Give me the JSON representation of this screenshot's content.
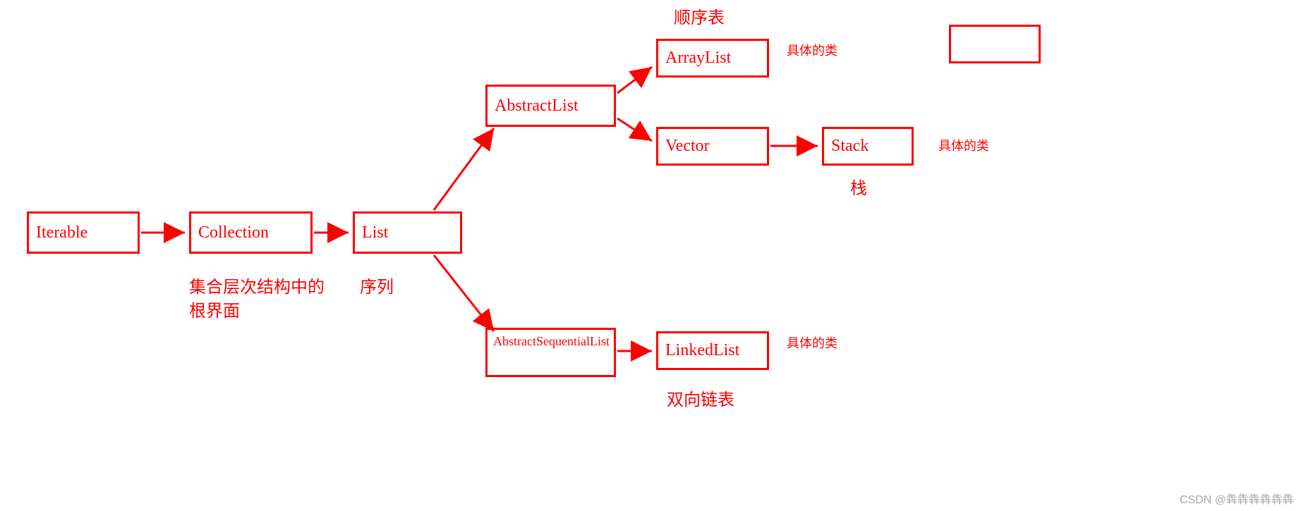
{
  "nodes": {
    "iterable": {
      "text": "Iterable"
    },
    "collection": {
      "text": "Collection"
    },
    "list": {
      "text": "List"
    },
    "abstractlist": {
      "text": "AbstractList"
    },
    "arraylist": {
      "text": "ArrayList"
    },
    "vector": {
      "text": "Vector"
    },
    "stack": {
      "text": "Stack"
    },
    "abstractseq": {
      "text": "AbstractSequentialList"
    },
    "linkedlist": {
      "text": "LinkedList"
    }
  },
  "labels": {
    "collection_sub": "集合层次结构中的根界面",
    "list_sub": "序列",
    "arraylist_top": "顺序表",
    "arraylist_right": "具体的类",
    "stack_sub": "栈",
    "stack_right": "具体的类",
    "linkedlist_sub": "双向链表",
    "linkedlist_right": "具体的类"
  },
  "watermark": "CSDN @犇犇犇犇犇犇"
}
